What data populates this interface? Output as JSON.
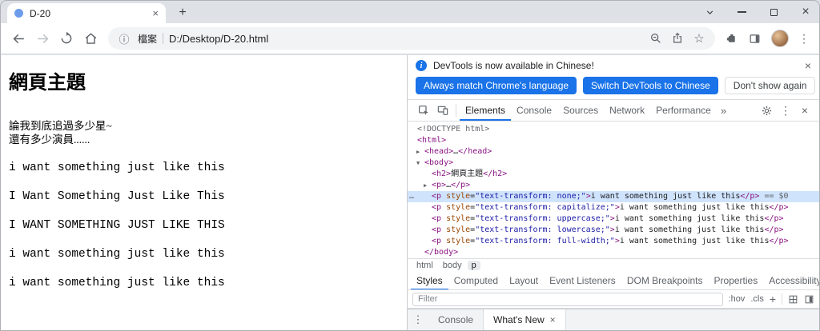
{
  "icons": {
    "info": "i",
    "close": "×",
    "new_tab": "+",
    "kebab": "⋮",
    "star": "☆",
    "more_tabs": "»",
    "scheme_info": "ⓘ",
    "ellipsis_menu": "…"
  },
  "titlebar": {
    "tab_title": "D-20"
  },
  "toolbar": {
    "address": {
      "scheme_label": "檔案",
      "url": "D:/Desktop/D-20.html"
    }
  },
  "page": {
    "heading": "網頁主題",
    "intro_lines": [
      "論我到底追過多少星~",
      "還有多少演員......"
    ],
    "transform_lines": [
      "i want something just like this",
      "I Want Something Just Like This",
      "I WANT SOMETHING JUST LIKE THIS",
      "i want something just like this",
      "i want something just like this"
    ]
  },
  "devtools": {
    "infobar": {
      "message": "DevTools is now available in Chinese!",
      "primary_button": "Always match Chrome's language",
      "secondary_button": "Switch DevTools to Chinese",
      "dismiss_button": "Don't show again"
    },
    "panel_tabs": [
      "Elements",
      "Console",
      "Sources",
      "Network",
      "Performance"
    ],
    "tree_rows": [
      {
        "indent": 0,
        "tokens": [
          [
            "<!DOCTYPE html>",
            "gray"
          ]
        ]
      },
      {
        "indent": 0,
        "tokens": [
          [
            "<html>",
            "tag"
          ]
        ]
      },
      {
        "indent": 1,
        "arrow": "▶",
        "tokens": [
          [
            "<head>",
            "tag"
          ],
          [
            "…",
            "text"
          ],
          [
            "</head>",
            "tag"
          ]
        ]
      },
      {
        "indent": 1,
        "arrow": "▼",
        "tokens": [
          [
            "<body>",
            "tag"
          ]
        ]
      },
      {
        "indent": 2,
        "tokens": [
          [
            "<h2>",
            "tag"
          ],
          [
            "網頁主題",
            "text"
          ],
          [
            "</h2>",
            "tag"
          ]
        ]
      },
      {
        "indent": 2,
        "arrow": "▶",
        "tokens": [
          [
            "<p>",
            "tag"
          ],
          [
            "…",
            "text"
          ],
          [
            "</p>",
            "tag"
          ]
        ]
      },
      {
        "indent": 2,
        "selected": true,
        "tokens": [
          [
            "<p ",
            "tag"
          ],
          [
            "style",
            "attr"
          ],
          [
            "=",
            "text"
          ],
          [
            "\"text-transform: none;\"",
            "val"
          ],
          [
            ">",
            "tag"
          ],
          [
            "i want something just like this",
            "text"
          ],
          [
            "</p>",
            "tag"
          ],
          [
            " == $0",
            "gray"
          ]
        ]
      },
      {
        "indent": 2,
        "tokens": [
          [
            "<p ",
            "tag"
          ],
          [
            "style",
            "attr"
          ],
          [
            "=",
            "text"
          ],
          [
            "\"text-transform: capitalize;\"",
            "val"
          ],
          [
            ">",
            "tag"
          ],
          [
            "i want something just like this",
            "text"
          ],
          [
            "</p>",
            "tag"
          ]
        ]
      },
      {
        "indent": 2,
        "tokens": [
          [
            "<p ",
            "tag"
          ],
          [
            "style",
            "attr"
          ],
          [
            "=",
            "text"
          ],
          [
            "\"text-transform: uppercase;\"",
            "val"
          ],
          [
            ">",
            "tag"
          ],
          [
            "i want something just like this",
            "text"
          ],
          [
            "</p>",
            "tag"
          ]
        ]
      },
      {
        "indent": 2,
        "tokens": [
          [
            "<p ",
            "tag"
          ],
          [
            "style",
            "attr"
          ],
          [
            "=",
            "text"
          ],
          [
            "\"text-transform: lowercase;\"",
            "val"
          ],
          [
            ">",
            "tag"
          ],
          [
            "i want something just like this",
            "text"
          ],
          [
            "</p>",
            "tag"
          ]
        ]
      },
      {
        "indent": 2,
        "tokens": [
          [
            "<p ",
            "tag"
          ],
          [
            "style",
            "attr"
          ],
          [
            "=",
            "text"
          ],
          [
            "\"text-transform: full-width;\"",
            "val"
          ],
          [
            ">",
            "tag"
          ],
          [
            "i want something just like this",
            "text"
          ],
          [
            "</p>",
            "tag"
          ]
        ]
      },
      {
        "indent": 1,
        "tokens": [
          [
            "</body>",
            "tag"
          ]
        ]
      },
      {
        "indent": 0,
        "tokens": [
          [
            "</html>",
            "tag"
          ]
        ]
      }
    ],
    "breadcrumbs": [
      "html",
      "body",
      "p"
    ],
    "sidebar_tabs": [
      "Styles",
      "Computed",
      "Layout",
      "Event Listeners",
      "DOM Breakpoints",
      "Properties",
      "Accessibility"
    ],
    "filter": {
      "placeholder": "Filter",
      "pseudo_toggle": ":hov",
      "class_toggle": ".cls",
      "add_toggle": "+"
    },
    "drawer_tabs": [
      "Console",
      "What's New"
    ]
  }
}
